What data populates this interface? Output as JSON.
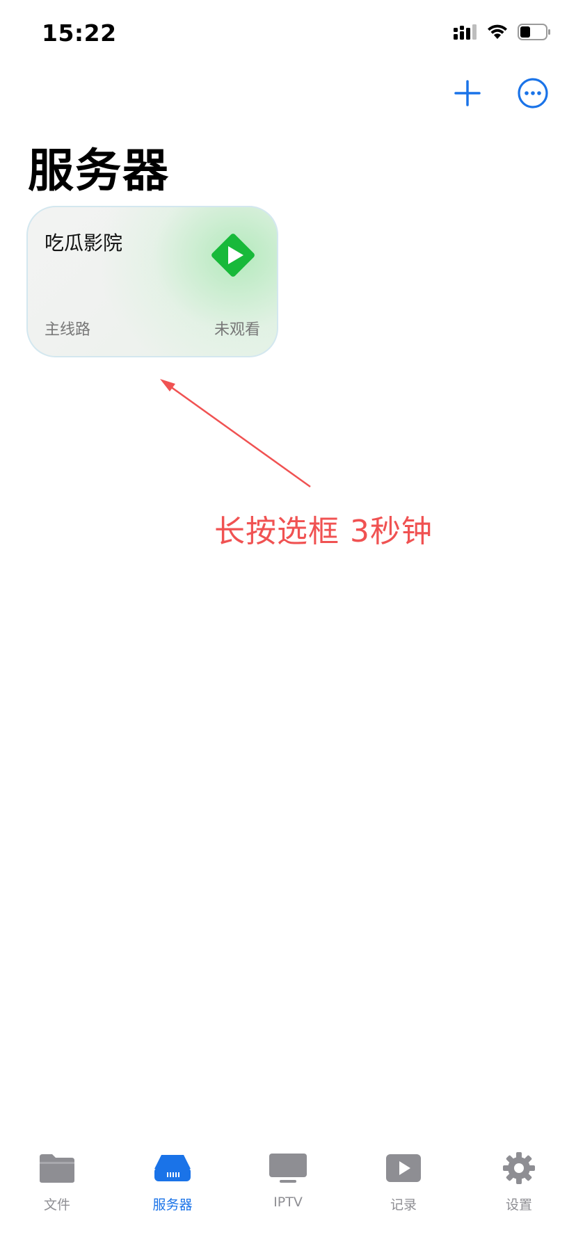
{
  "status_bar": {
    "time": "15:22"
  },
  "nav": {
    "add_icon": "plus-icon",
    "more_icon": "ellipsis-circle-icon"
  },
  "page": {
    "title": "服务器"
  },
  "server_card": {
    "name": "吃瓜影院",
    "line": "主线路",
    "status": "未观看",
    "logo_color": "#18b93a"
  },
  "annotation": {
    "text": "长按选框 3秒钟",
    "color": "#f05252"
  },
  "tabs": [
    {
      "label": "文件",
      "icon": "folder-icon",
      "active": false
    },
    {
      "label": "服务器",
      "icon": "server-icon",
      "active": true
    },
    {
      "label": "IPTV",
      "icon": "tv-icon",
      "active": false
    },
    {
      "label": "记录",
      "icon": "play-record-icon",
      "active": false
    },
    {
      "label": "设置",
      "icon": "gear-icon",
      "active": false
    }
  ],
  "colors": {
    "accent": "#1a73e8",
    "inactive": "#8e8e93",
    "annotation": "#f05252"
  }
}
